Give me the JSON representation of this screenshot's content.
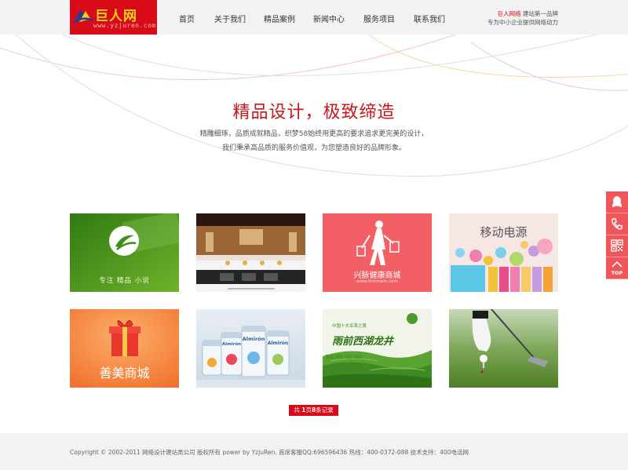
{
  "header": {
    "logo": {
      "brand": "巨人网",
      "url": "www.yzjuren.com"
    },
    "nav": [
      "首页",
      "关于我们",
      "精品案例",
      "新闻中心",
      "服务项目",
      "联系我们"
    ],
    "tagline": {
      "brand": "巨人网络",
      "line1_rest": " 建站第一品牌",
      "line2": "专为中小企业提供网络动力"
    }
  },
  "hero": {
    "title": "精品设计，极致缔造",
    "desc_line1": "精雕细琢，品质成就精品，织梦58始终用更高的要求追求更完美的设计，",
    "desc_line2": "我们秉承高品质的服务价值观，为您塑造良好的品牌形象。"
  },
  "cases": [
    {
      "name": "case-novel",
      "text": "专注  精品  小说",
      "color": "#3f8f1a"
    },
    {
      "name": "case-hotel",
      "text": "",
      "color": "#2b1a12"
    },
    {
      "name": "case-health-mall",
      "text": "兴脉健康商城",
      "subtext": "www.thinmain.com",
      "color": "#f25f64"
    },
    {
      "name": "case-power-bank",
      "text": "移动电源",
      "color": "#f6e6e4"
    },
    {
      "name": "case-shanmei-mall",
      "text": "善美商城",
      "color": "#f47a37"
    },
    {
      "name": "case-milk-powder",
      "text": "Almirón",
      "color": "#dfe7ee"
    },
    {
      "name": "case-longjing-tea",
      "text": "中国十大名茶之首",
      "subtext": "雨前西湖龙井",
      "color": "#4f9a2e"
    },
    {
      "name": "case-golf",
      "text": "",
      "color": "#6aa03c"
    }
  ],
  "pager": {
    "prefix": "共 ",
    "pages": "1",
    "mid": "页",
    "records": "8",
    "suffix": "条记录"
  },
  "footer": {
    "copyright": "Copyright © 2002-2011 网络设计建站类公司 版权所有 power by YzjuRen. 首席客服QQ:696596436 热线：400-0372-088 技术支持：400电话网"
  },
  "side_tools": {
    "top_label": "TOP",
    "icons": [
      "qq-icon",
      "phone-icon",
      "qrcode-icon",
      "back-to-top-icon"
    ]
  },
  "colors": {
    "brand_red": "#d80c18",
    "title_red": "#c8161d",
    "side_red": "#f0555a"
  }
}
